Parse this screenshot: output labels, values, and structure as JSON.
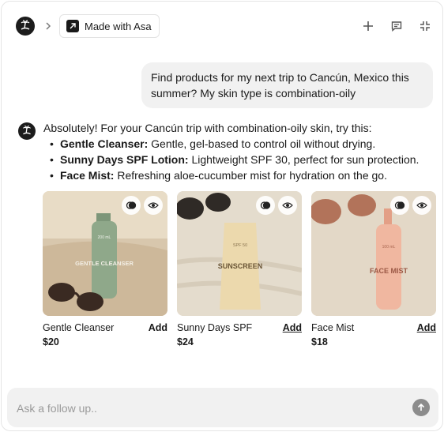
{
  "header": {
    "breadcrumb_label": "Made with Asa",
    "icons": [
      "plus-icon",
      "chat-icon",
      "collapse-icon"
    ]
  },
  "user_message": {
    "text": "Find products for my next trip to Cancún, Mexico this summer? My skin type is combination-oily"
  },
  "assistant_message": {
    "intro": "Absolutely! For your Cancún trip with combination-oily skin, try this:",
    "items": [
      {
        "title": "Gentle Cleanser:",
        "desc": " Gentle, gel-based to control oil without drying."
      },
      {
        "title": "Sunny Days SPF Lotion:",
        "desc": " Lightweight SPF 30, perfect for sun protection."
      },
      {
        "title": "Face Mist:",
        "desc": " Refreshing aloe-cucumber mist for hydration on the go."
      }
    ]
  },
  "products": [
    {
      "name": "Gentle Cleanser",
      "price": "$20",
      "add_label": "Add",
      "bottle_text": "GENTLE CLEANSER",
      "bottle_top": "200 mL",
      "bottle_color": "#8fa88a",
      "bg_color": "#d8c7ad"
    },
    {
      "name": "Sunny Days SPF",
      "price": "$24",
      "add_label": "Add",
      "bottle_text": "SUNSCREEN",
      "bottle_top": "SPF 50",
      "bottle_color": "#ecd9ad",
      "bg_color": "#e7e0d3"
    },
    {
      "name": "Face Mist",
      "price": "$18",
      "add_label": "Add",
      "bottle_text": "FACE MIST",
      "bottle_top": "100 mL",
      "bottle_color": "#f0b7a0",
      "bg_color": "#e6dccd"
    }
  ],
  "input": {
    "placeholder": "Ask a follow up.."
  },
  "colors": {
    "bubble_bg": "#f1f1f1",
    "send_button": "#8c8c8c"
  }
}
